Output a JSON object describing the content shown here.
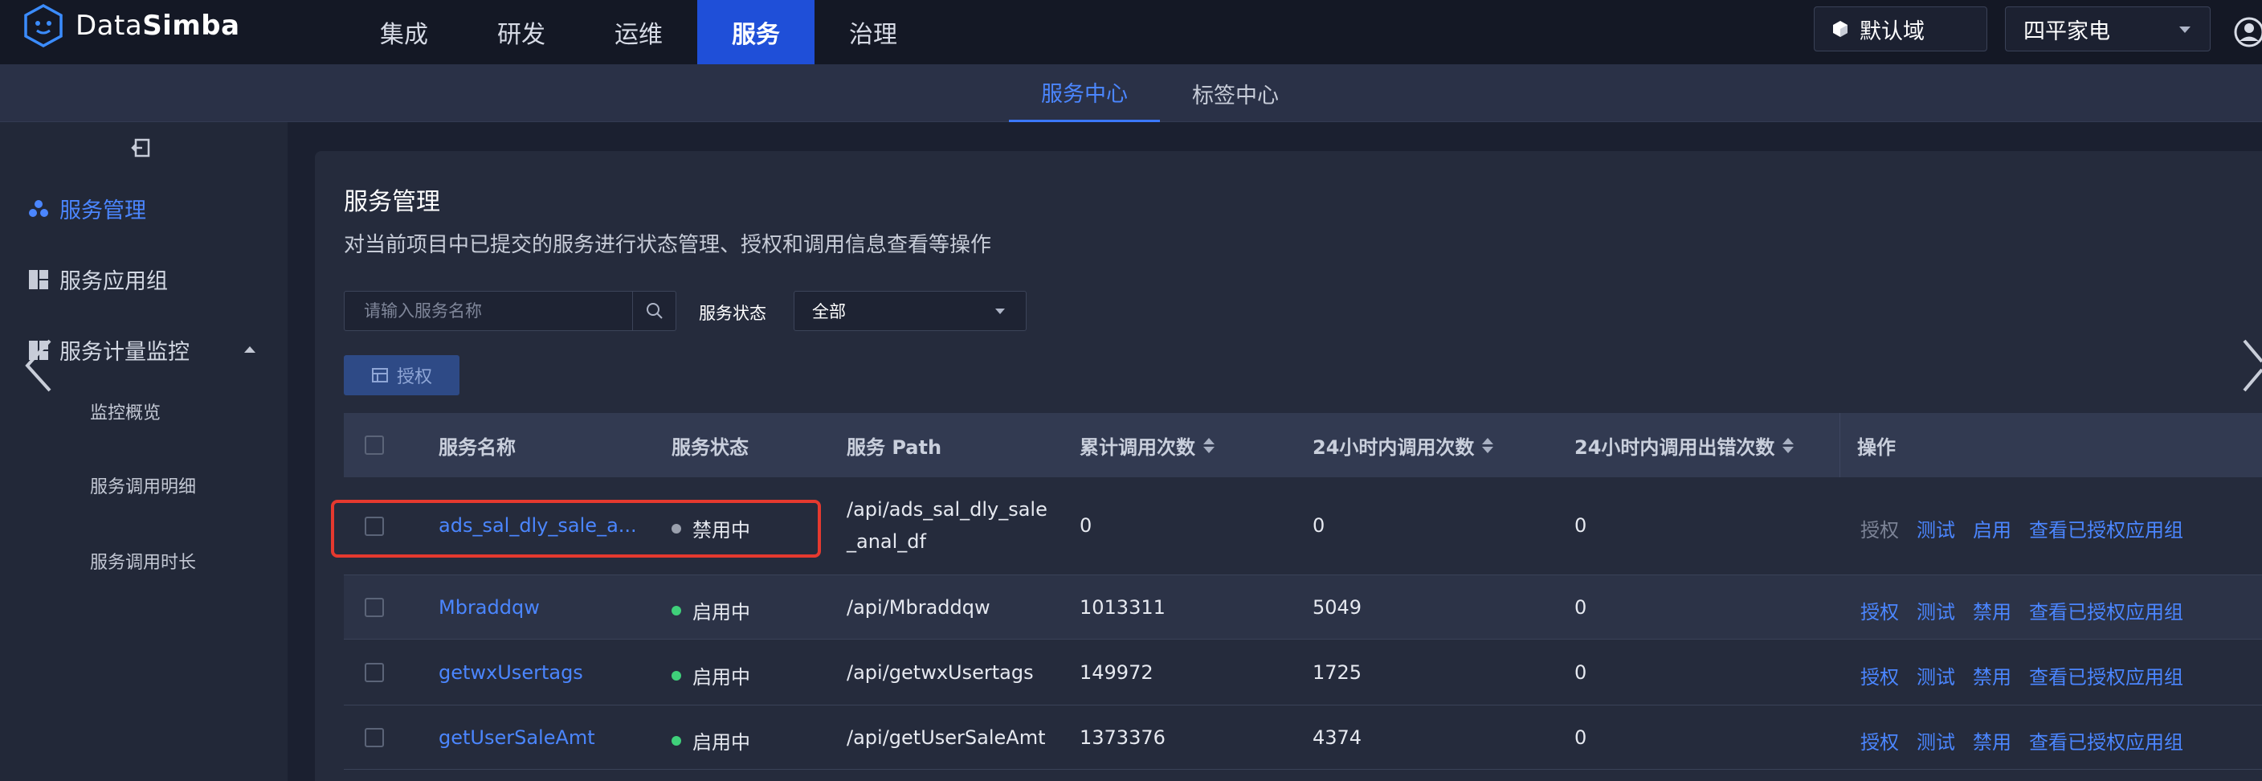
{
  "header": {
    "logo_text_light": "Data",
    "logo_text_bold": "Simba",
    "nav": [
      "集成",
      "研发",
      "运维",
      "服务",
      "治理"
    ],
    "nav_active_index": 3,
    "domain": "默认域",
    "project": "四平家电"
  },
  "subnav": {
    "tabs": [
      "服务中心",
      "标签中心"
    ],
    "active_index": 0
  },
  "sidebar": {
    "items": [
      "服务管理",
      "服务应用组",
      "服务计量监控"
    ],
    "sub_items": [
      "监控概览",
      "服务调用明细",
      "服务调用时长"
    ]
  },
  "main": {
    "title": "服务管理",
    "description": "对当前项目中已提交的服务进行状态管理、授权和调用信息查看等操作",
    "search_placeholder": "请输入服务名称",
    "status_label": "服务状态",
    "status_value": "全部",
    "auth_button": "授权"
  },
  "table": {
    "columns": [
      "服务名称",
      "服务状态",
      "服务 Path",
      "累计调用次数",
      "24小时内调用次数",
      "24小时内调用出错次数",
      "操作"
    ],
    "rows": [
      {
        "name": "ads_sal_dly_sale_a...",
        "status": "禁用中",
        "path_line1": "/api/ads_sal_dly_sale",
        "path_line2": "_anal_df",
        "total_calls": "0",
        "calls_24h": "0",
        "errors_24h": "0",
        "ops": [
          "授权",
          "测试",
          "启用",
          "查看已授权应用组"
        ]
      },
      {
        "name": "Mbraddqw",
        "status": "启用中",
        "path_line1": "/api/Mbraddqw",
        "path_line2": "",
        "total_calls": "1013311",
        "calls_24h": "5049",
        "errors_24h": "0",
        "ops": [
          "授权",
          "测试",
          "禁用",
          "查看已授权应用组"
        ]
      },
      {
        "name": "getwxUsertags",
        "status": "启用中",
        "path_line1": "/api/getwxUsertags",
        "path_line2": "",
        "total_calls": "149972",
        "calls_24h": "1725",
        "errors_24h": "0",
        "ops": [
          "授权",
          "测试",
          "禁用",
          "查看已授权应用组"
        ]
      },
      {
        "name": "getUserSaleAmt",
        "status": "启用中",
        "path_line1": "/api/getUserSaleAmt",
        "path_line2": "",
        "total_calls": "1373376",
        "calls_24h": "4374",
        "errors_24h": "0",
        "ops": [
          "授权",
          "测试",
          "禁用",
          "查看已授权应用组"
        ]
      }
    ]
  },
  "colors": {
    "accent": "#3b78ff",
    "enabled_dot": "#3fd07a",
    "disabled_dot": "#9aa0ad",
    "highlight": "#e5392f"
  }
}
